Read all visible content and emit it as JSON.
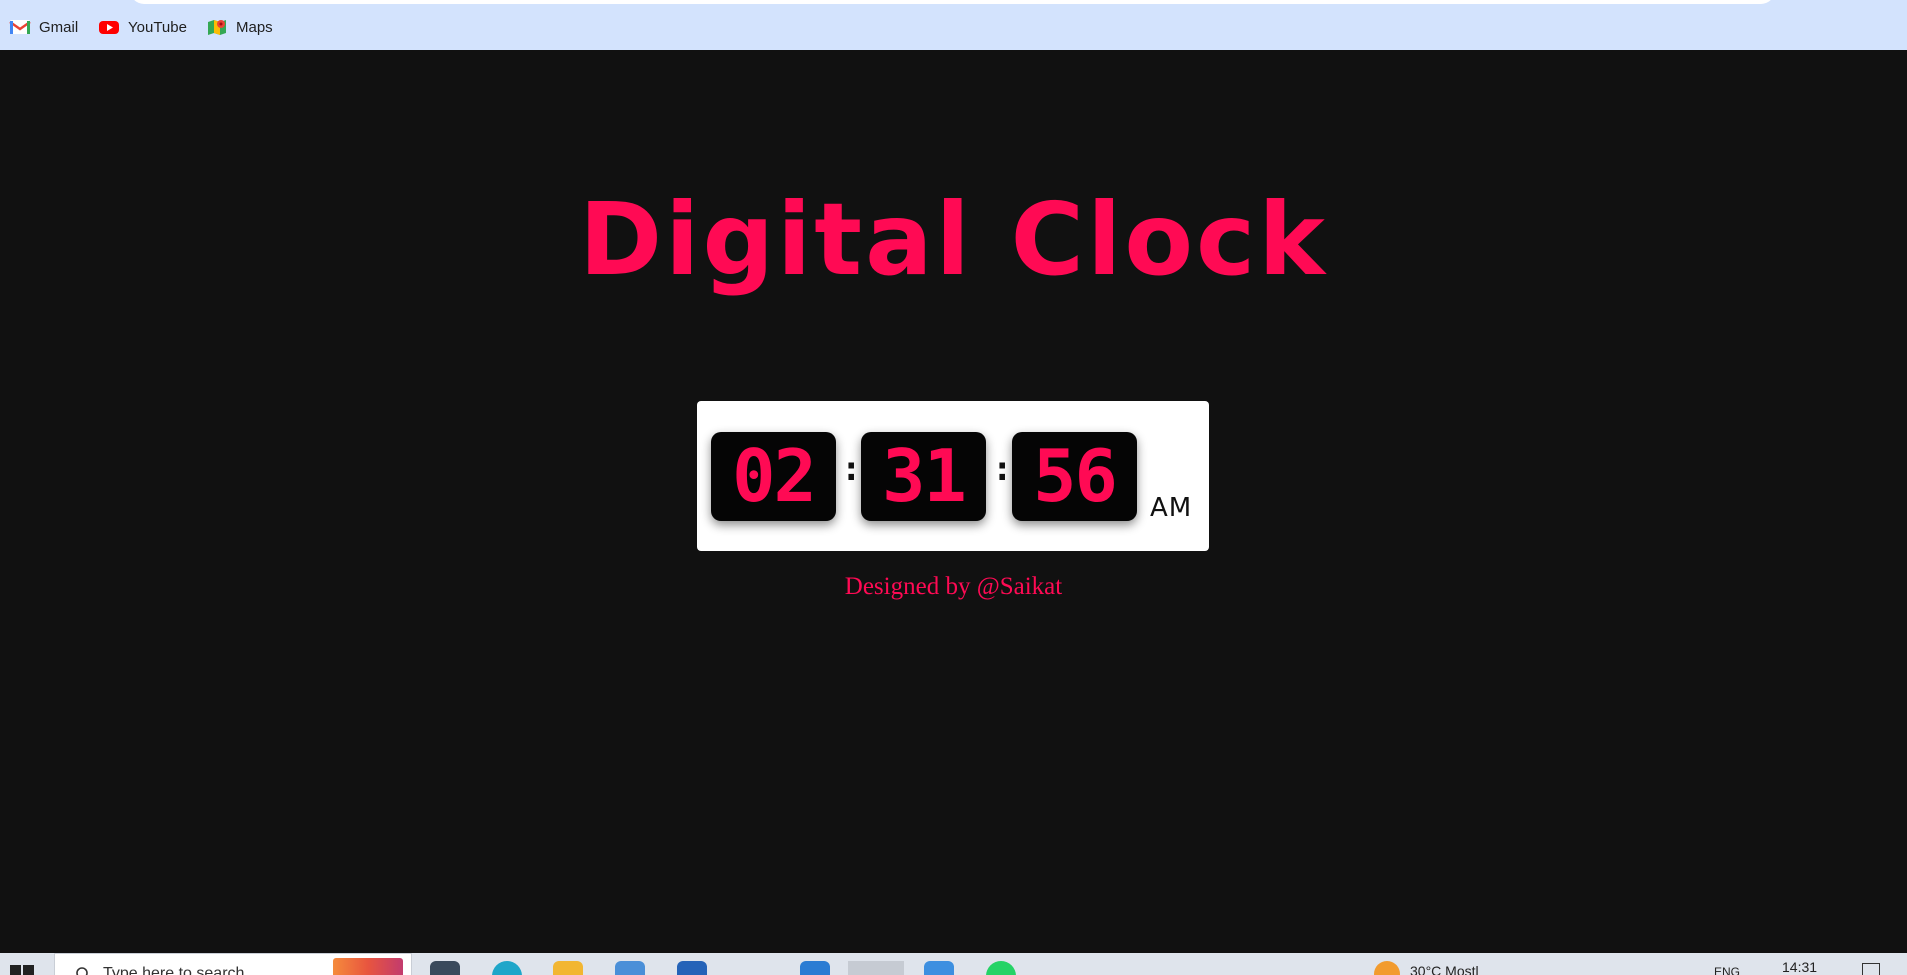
{
  "bookmarks": [
    {
      "label": "Gmail",
      "icon": "gmail-icon"
    },
    {
      "label": "YouTube",
      "icon": "youtube-icon"
    },
    {
      "label": "Maps",
      "icon": "maps-icon"
    }
  ],
  "page": {
    "title": "Digital Clock",
    "clock": {
      "hours": "02",
      "minutes": "31",
      "seconds": "56",
      "separator": ":",
      "period": "AM"
    },
    "credit": "Designed by @Saikat"
  },
  "taskbar": {
    "search_placeholder": "Type here to search",
    "weather": "30°C  Mostl",
    "language": "ENG",
    "time": "14:31"
  },
  "colors": {
    "accent": "#ff0a54",
    "background": "#111111",
    "bookmark_bar": "#d3e3fd"
  }
}
